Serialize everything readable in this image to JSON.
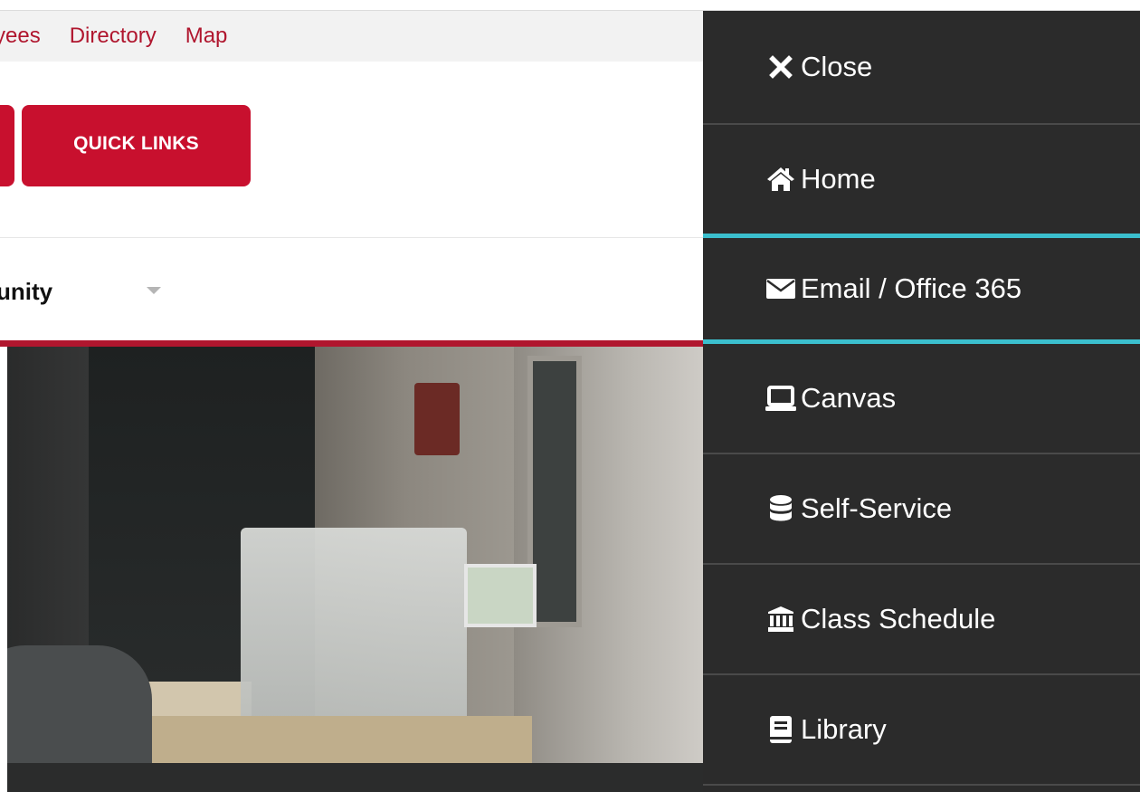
{
  "utility_nav": {
    "links": [
      "yees",
      "Directory",
      "Map"
    ]
  },
  "header": {
    "quick_links_label": "QUICK LINKS"
  },
  "main_menu": {
    "partial_label": "unity"
  },
  "side_panel": {
    "accent_color": "#3bbfce",
    "background_color": "#2b2b2b",
    "items": [
      {
        "icon": "close-icon",
        "label": "Close"
      },
      {
        "icon": "home-icon",
        "label": "Home"
      },
      {
        "icon": "envelope-icon",
        "label": "Email / Office 365",
        "active": true
      },
      {
        "icon": "laptop-icon",
        "label": "Canvas"
      },
      {
        "icon": "database-icon",
        "label": "Self-Service"
      },
      {
        "icon": "institution-icon",
        "label": "Class Schedule"
      },
      {
        "icon": "book-icon",
        "label": "Library"
      }
    ]
  },
  "brand_color": "#c8102e"
}
